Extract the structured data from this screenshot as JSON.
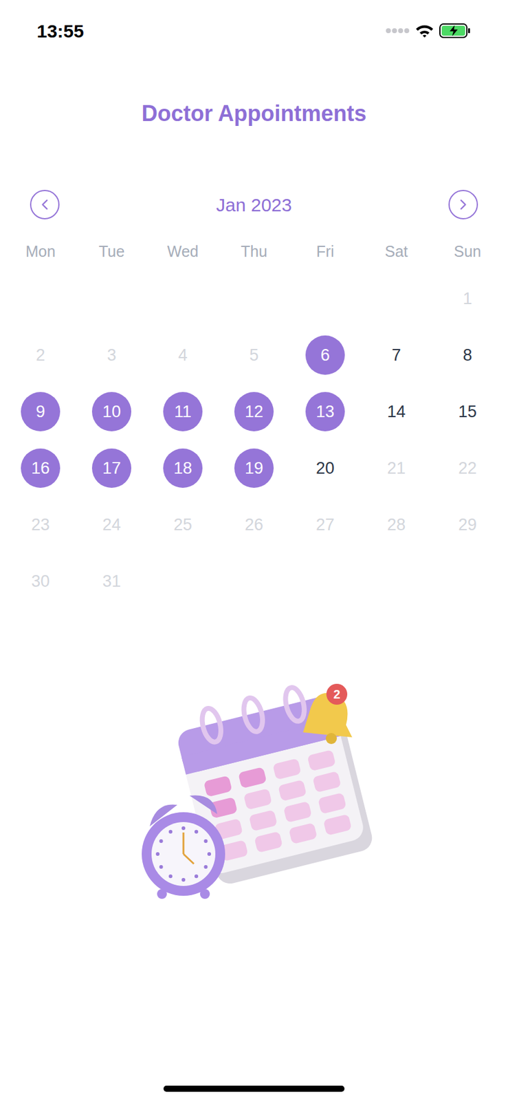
{
  "status_bar": {
    "time": "13:55",
    "charging": true
  },
  "title": "Doctor Appointments",
  "calendar": {
    "month": "Jan 2023",
    "prev_label": "‹",
    "next_label": "›",
    "weekdays": [
      "Mon",
      "Tue",
      "Wed",
      "Thu",
      "Fri",
      "Sat",
      "Sun"
    ],
    "weeks": [
      [
        null,
        null,
        null,
        null,
        null,
        null,
        {
          "day": "1",
          "kind": "disabled"
        }
      ],
      [
        {
          "day": "2",
          "kind": "disabled"
        },
        {
          "day": "3",
          "kind": "disabled"
        },
        {
          "day": "4",
          "kind": "disabled"
        },
        {
          "day": "5",
          "kind": "disabled"
        },
        {
          "day": "6",
          "kind": "appointment"
        },
        {
          "day": "7",
          "kind": "available"
        },
        {
          "day": "8",
          "kind": "available"
        }
      ],
      [
        {
          "day": "9",
          "kind": "appointment"
        },
        {
          "day": "10",
          "kind": "appointment"
        },
        {
          "day": "11",
          "kind": "appointment"
        },
        {
          "day": "12",
          "kind": "appointment"
        },
        {
          "day": "13",
          "kind": "appointment"
        },
        {
          "day": "14",
          "kind": "available"
        },
        {
          "day": "15",
          "kind": "available"
        }
      ],
      [
        {
          "day": "16",
          "kind": "appointment"
        },
        {
          "day": "17",
          "kind": "appointment"
        },
        {
          "day": "18",
          "kind": "appointment"
        },
        {
          "day": "19",
          "kind": "appointment"
        },
        {
          "day": "20",
          "kind": "available"
        },
        {
          "day": "21",
          "kind": "disabled"
        },
        {
          "day": "22",
          "kind": "disabled"
        }
      ],
      [
        {
          "day": "23",
          "kind": "disabled"
        },
        {
          "day": "24",
          "kind": "disabled"
        },
        {
          "day": "25",
          "kind": "disabled"
        },
        {
          "day": "26",
          "kind": "disabled"
        },
        {
          "day": "27",
          "kind": "disabled"
        },
        {
          "day": "28",
          "kind": "disabled"
        },
        {
          "day": "29",
          "kind": "disabled"
        }
      ],
      [
        {
          "day": "30",
          "kind": "disabled"
        },
        {
          "day": "31",
          "kind": "disabled"
        },
        null,
        null,
        null,
        null,
        null
      ]
    ]
  },
  "illustration": {
    "badge": "2"
  }
}
